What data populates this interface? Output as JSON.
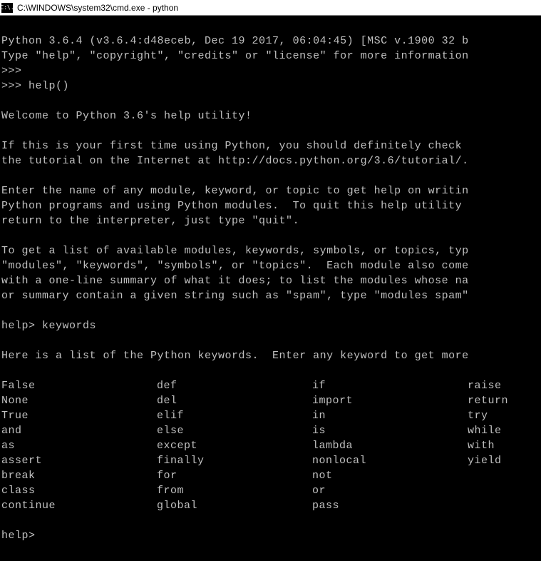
{
  "titlebar": {
    "icon_text": "C:\\.",
    "title": "C:\\WINDOWS\\system32\\cmd.exe - python"
  },
  "terminal": {
    "line1": "Python 3.6.4 (v3.6.4:d48eceb, Dec 19 2017, 06:04:45) [MSC v.1900 32 b",
    "line2": "Type \"help\", \"copyright\", \"credits\" or \"license\" for more information",
    "prompt1": ">>>",
    "prompt2": ">>> help()",
    "welcome": "Welcome to Python 3.6's help utility!",
    "para1_line1": "If this is your first time using Python, you should definitely check ",
    "para1_line2": "the tutorial on the Internet at http://docs.python.org/3.6/tutorial/.",
    "para2_line1": "Enter the name of any module, keyword, or topic to get help on writin",
    "para2_line2": "Python programs and using Python modules.  To quit this help utility ",
    "para2_line3": "return to the interpreter, just type \"quit\".",
    "para3_line1": "To get a list of available modules, keywords, symbols, or topics, typ",
    "para3_line2": "\"modules\", \"keywords\", \"symbols\", or \"topics\".  Each module also come",
    "para3_line3": "with a one-line summary of what it does; to list the modules whose na",
    "para3_line4": "or summary contain a given string such as \"spam\", type \"modules spam\"",
    "help_prompt1": "help> keywords",
    "keywords_intro": "Here is a list of the Python keywords.  Enter any keyword to get more",
    "help_prompt2": "help>"
  },
  "keywords": {
    "col1": [
      "False",
      "None",
      "True",
      "and",
      "as",
      "assert",
      "break",
      "class",
      "continue"
    ],
    "col2": [
      "def",
      "del",
      "elif",
      "else",
      "except",
      "finally",
      "for",
      "from",
      "global"
    ],
    "col3": [
      "if",
      "import",
      "in",
      "is",
      "lambda",
      "nonlocal",
      "not",
      "or",
      "pass"
    ],
    "col4": [
      "raise",
      "return",
      "try",
      "while",
      "with",
      "yield",
      "",
      "",
      ""
    ]
  }
}
